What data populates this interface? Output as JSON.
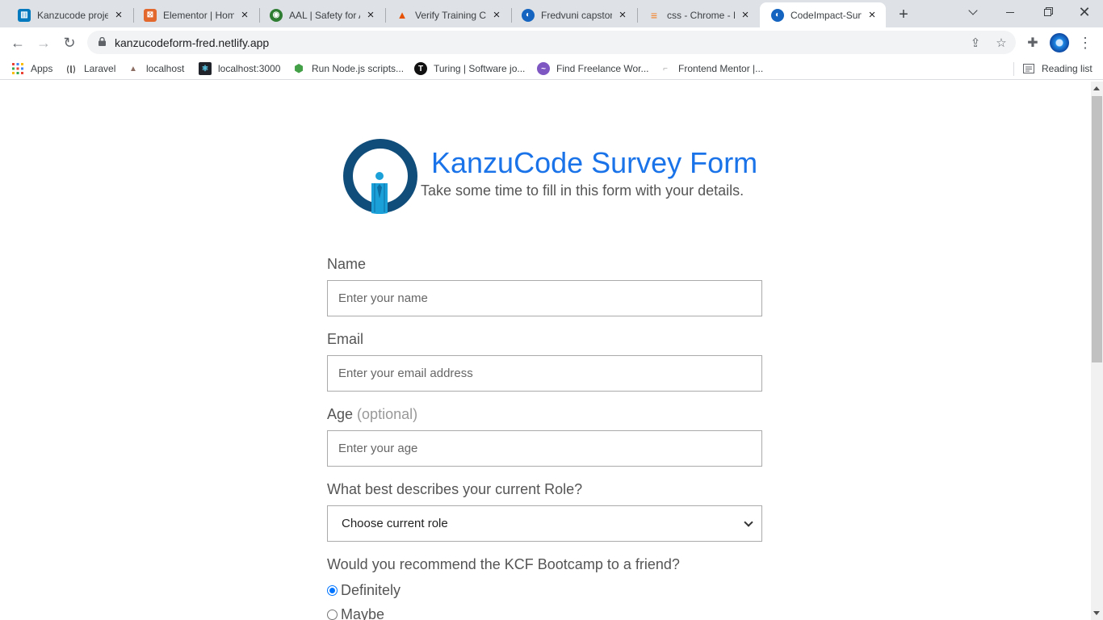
{
  "browser": {
    "tabs": [
      {
        "label": "Kanzucode project",
        "icon": "trello-icon",
        "color": "#0079bf",
        "glyph": "▥"
      },
      {
        "label": "Elementor | Home",
        "icon": "elementor-icon",
        "color": "#e2682e",
        "glyph": "⊠"
      },
      {
        "label": "AAL | Safety for All",
        "icon": "globe-icon",
        "color": "#2e7d32",
        "glyph": "◉"
      },
      {
        "label": "Verify Training Certificate",
        "icon": "certificate-icon",
        "color": "#e65100",
        "glyph": "▲"
      },
      {
        "label": "Fredvuni capstone",
        "icon": "netlify-icon",
        "color": "#1565c0",
        "glyph": "◐"
      },
      {
        "label": "css - Chrome - Fonts",
        "icon": "stackoverflow-icon",
        "color": "#f48024",
        "glyph": "≡"
      },
      {
        "label": "CodeImpact-Survey",
        "icon": "netlify-icon",
        "color": "#1565c0",
        "glyph": "◐"
      }
    ],
    "active_tab": 6,
    "url": "kanzucodeform-fred.netlify.app",
    "bookmarks": [
      {
        "label": "Apps",
        "icon": "apps-grid-icon"
      },
      {
        "label": "Laravel",
        "icon": "laravel-icon"
      },
      {
        "label": "localhost",
        "icon": "localhost-icon"
      },
      {
        "label": "localhost:3000",
        "icon": "react-icon"
      },
      {
        "label": "Run Node.js scripts...",
        "icon": "nodejs-icon"
      },
      {
        "label": "Turing | Software jo...",
        "icon": "turing-icon"
      },
      {
        "label": "Find Freelance Wor...",
        "icon": "freelance-icon"
      },
      {
        "label": "Frontend Mentor |...",
        "icon": "frontend-mentor-icon"
      }
    ],
    "reading_list": "Reading list"
  },
  "page": {
    "title": "KanzuCode Survey Form",
    "subtitle": "Take some time to fill in this form with your details.",
    "brand_color": "#1a73e8",
    "logo": "kanzucode-logo",
    "form": {
      "name": {
        "label": "Name",
        "placeholder": "Enter your name"
      },
      "email": {
        "label": "Email",
        "placeholder": "Enter your email address"
      },
      "age": {
        "label": "Age",
        "optional": "(optional)",
        "placeholder": "Enter your age"
      },
      "role": {
        "label": "What best describes your current Role?",
        "selected": "Choose current role"
      },
      "recommend": {
        "label": "Would you recommend the KCF Bootcamp to a friend?",
        "options": [
          "Definitely",
          "Maybe"
        ],
        "selected": "Definitely"
      }
    }
  }
}
